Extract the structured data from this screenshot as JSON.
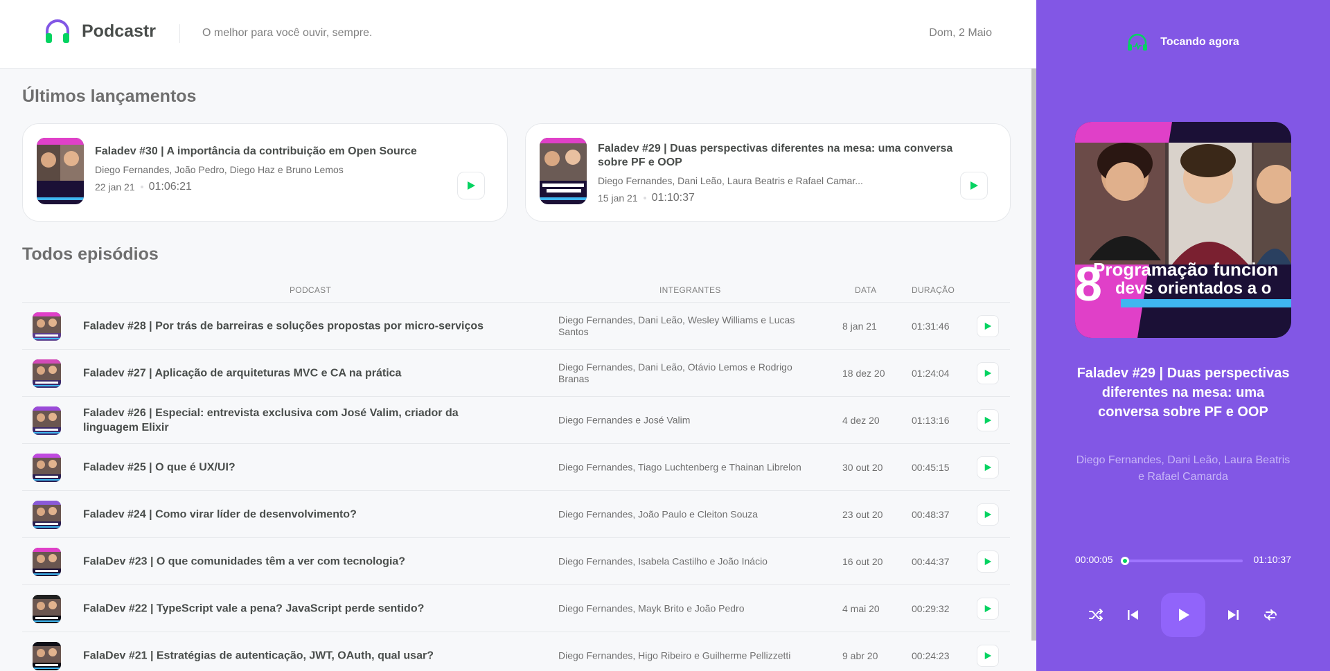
{
  "header": {
    "app_name": "Podcastr",
    "tagline": "O melhor para você ouvir, sempre.",
    "date": "Dom, 2 Maio"
  },
  "latest": {
    "title": "Últimos lançamentos",
    "episodes": [
      {
        "title": "Faladev #30 | A importância da contribuição em Open Source",
        "members": "Diego Fernandes, João Pedro, Diego Haz e Bruno Lemos",
        "date": "22 jan 21",
        "duration": "01:06:21",
        "thumb_text": "Por que é tão contribuir em Ope"
      },
      {
        "title": "Faladev #29 | Duas perspectivas diferentes na mesa: uma conversa sobre PF e OOP",
        "members": "Diego Fernandes, Dani Leão, Laura Beatris e Rafael Camar...",
        "date": "15 jan 21",
        "duration": "01:10:37",
        "thumb_text": "ogramação func devs orientados"
      }
    ]
  },
  "all": {
    "title": "Todos episódios",
    "columns": {
      "podcast": "Podcast",
      "members": "Integrantes",
      "date": "Data",
      "duration": "Duração"
    },
    "rows": [
      {
        "title": "Faladev #28 | Por trás de barreiras e soluções propostas por micro-serviços",
        "members": "Diego Fernandes, Dani Leão, Wesley Williams e Lucas Santos",
        "date": "8 jan 21",
        "duration": "01:31:46"
      },
      {
        "title": "Faladev #27 | Aplicação de arquiteturas MVC e CA na prática",
        "members": "Diego Fernandes, Dani Leão, Otávio Lemos e Rodrigo Branas",
        "date": "18 dez 20",
        "duration": "01:24:04"
      },
      {
        "title": "Faladev #26 | Especial: entrevista exclusiva com José Valim, criador da linguagem Elixir",
        "members": "Diego Fernandes e José Valim",
        "date": "4 dez 20",
        "duration": "01:13:16"
      },
      {
        "title": "Faladev #25 | O que é UX/UI?",
        "members": "Diego Fernandes, Tiago Luchtenberg e Thainan Librelon",
        "date": "30 out 20",
        "duration": "00:45:15"
      },
      {
        "title": "Faladev #24 | Como virar líder de desenvolvimento?",
        "members": "Diego Fernandes, João Paulo e Cleiton Souza",
        "date": "23 out 20",
        "duration": "00:48:37"
      },
      {
        "title": "FalaDev #23 | O que comunidades têm a ver com tecnologia?",
        "members": "Diego Fernandes, Isabela Castilho e João Inácio",
        "date": "16 out 20",
        "duration": "00:44:37"
      },
      {
        "title": "FalaDev #22 | TypeScript vale a pena? JavaScript perde sentido?",
        "members": "Diego Fernandes, Mayk Brito e João Pedro",
        "date": "4 mai 20",
        "duration": "00:29:32"
      },
      {
        "title": "FalaDev #21 | Estratégias de autenticação, JWT, OAuth, qual usar?",
        "members": "Diego Fernandes, Higo Ribeiro e Guilherme Pellizzetti",
        "date": "9 abr 20",
        "duration": "00:24:23"
      }
    ]
  },
  "player": {
    "label": "Tocando agora",
    "title": "Faladev #29 | Duas perspectivas diferentes na mesa: uma conversa sobre PF e OOP",
    "members": "Diego Fernandes, Dani Leão, Laura Beatris e Rafael Camarda",
    "current_time": "00:00:05",
    "total_time": "01:10:37",
    "progress": 0.01,
    "cover_text_line1": "Programação funcion",
    "cover_text_line2": "devs orientados a o",
    "cover_number": "8",
    "icons": [
      "shuffle-icon",
      "previous-icon",
      "play-icon",
      "next-icon",
      "repeat-icon"
    ]
  },
  "colors": {
    "purple": "#8257e5",
    "green": "#04d361",
    "text": "#494d4b"
  }
}
